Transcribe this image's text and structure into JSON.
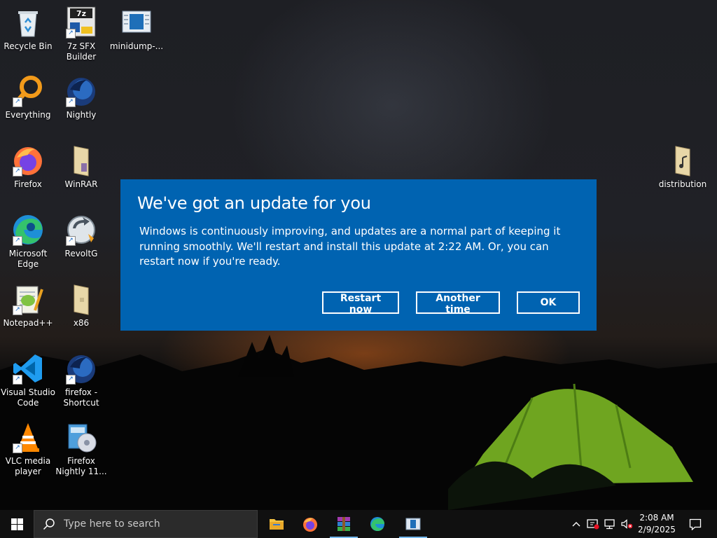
{
  "desktop_icons": [
    {
      "label": "Recycle Bin",
      "icon": "recycle-bin-icon"
    },
    {
      "label": "7z SFX Builder",
      "icon": "7z-sfx-builder-icon"
    },
    {
      "label": "minidump-...",
      "icon": "document-icon"
    },
    {
      "label": "Everything",
      "icon": "everything-search-icon"
    },
    {
      "label": "Nightly",
      "icon": "firefox-nightly-icon"
    },
    {
      "label": "Firefox",
      "icon": "firefox-icon"
    },
    {
      "label": "WinRAR",
      "icon": "folder-icon"
    },
    {
      "label": "distribution",
      "icon": "folder-music-icon"
    },
    {
      "label": "Microsoft Edge",
      "icon": "edge-icon"
    },
    {
      "label": "RevoltG",
      "icon": "revoltg-icon"
    },
    {
      "label": "Notepad++",
      "icon": "notepad-plus-plus-icon"
    },
    {
      "label": "x86",
      "icon": "folder-icon"
    },
    {
      "label": "Visual Studio Code",
      "icon": "vscode-icon"
    },
    {
      "label": "firefox - Shortcut",
      "icon": "firefox-nightly-icon"
    },
    {
      "label": "VLC media player",
      "icon": "vlc-icon"
    },
    {
      "label": "Firefox Nightly 11...",
      "icon": "installer-icon"
    }
  ],
  "dialog": {
    "title": "We've got an update for you",
    "body": "Windows is continuously improving, and updates are a normal part of keeping it running smoothly. We'll restart and install this update at 2:22 AM. Or, you can restart now if you're ready.",
    "buttons": {
      "restart_now": "Restart now",
      "another_time": "Another time",
      "ok": "OK"
    },
    "background_color": "#0063b1"
  },
  "taskbar": {
    "search_placeholder": "Type here to search",
    "pinned": [
      {
        "icon": "file-explorer-icon"
      },
      {
        "icon": "firefox-icon"
      },
      {
        "icon": "winrar-icon"
      },
      {
        "icon": "edge-icon"
      },
      {
        "icon": "app-window-icon"
      }
    ],
    "clock": {
      "time": "2:08 AM",
      "date": "2/9/2025"
    }
  }
}
